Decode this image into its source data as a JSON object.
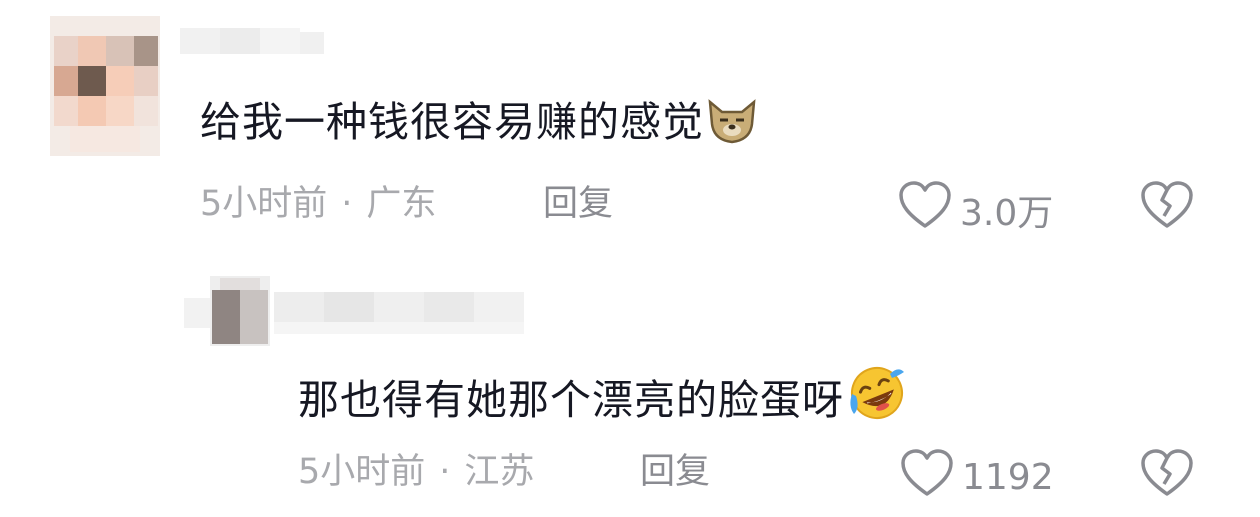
{
  "comments": [
    {
      "text": "给我一种钱很容易赚的感觉",
      "emoji": "smirking-dog-emoji",
      "time": "5小时前",
      "location": "广东",
      "separator": "·",
      "reply_label": "回复",
      "like_count": "3.0万"
    },
    {
      "text": "那也得有她那个漂亮的脸蛋呀",
      "emoji": "rofl-laughing-emoji",
      "time": "5小时前",
      "location": "江苏",
      "separator": "·",
      "reply_label": "回复",
      "like_count": "1192"
    }
  ],
  "icons": {
    "like": "heart-outline-icon",
    "dislike": "broken-heart-icon"
  },
  "colors": {
    "text": "#161823",
    "meta": "#a8a9ad",
    "action": "#8a8b91"
  }
}
